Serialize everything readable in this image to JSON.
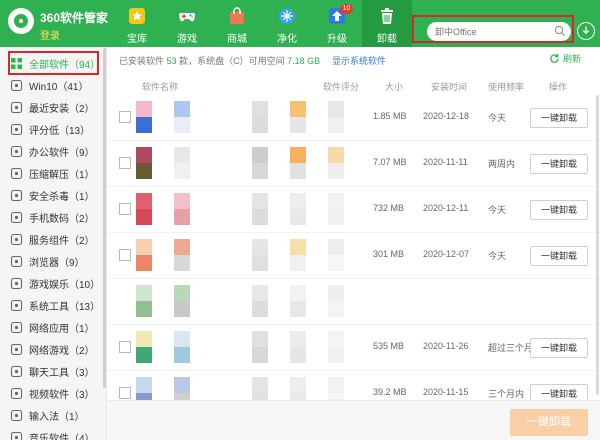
{
  "header": {
    "app_title": "360软件管家",
    "login_label": "登录",
    "nav": [
      {
        "label": "宝库",
        "icon": "star-icon"
      },
      {
        "label": "游戏",
        "icon": "gamepad-icon"
      },
      {
        "label": "商城",
        "icon": "shopping-bag-icon"
      },
      {
        "label": "净化",
        "icon": "purify-icon"
      },
      {
        "label": "升级",
        "icon": "upgrade-icon",
        "badge": "10"
      },
      {
        "label": "卸载",
        "icon": "trash-icon",
        "active": true
      }
    ],
    "search_placeholder": "卸中Office"
  },
  "sidebar": {
    "items": [
      {
        "label": "全部软件（94）",
        "icon": "grid-icon",
        "active": true
      },
      {
        "label": "Win10（41）",
        "icon": "windows-icon"
      },
      {
        "label": "最近安装（2）",
        "icon": "clock-icon"
      },
      {
        "label": "评分低（13）",
        "icon": "thumbs-down-icon"
      },
      {
        "label": "办公软件（9）",
        "icon": "briefcase-icon"
      },
      {
        "label": "压缩解压（1）",
        "icon": "archive-icon"
      },
      {
        "label": "安全杀毒（1）",
        "icon": "shield-icon"
      },
      {
        "label": "手机数码（2）",
        "icon": "phone-icon"
      },
      {
        "label": "服务组件（2）",
        "icon": "gear-icon"
      },
      {
        "label": "浏览器（9）",
        "icon": "globe-icon"
      },
      {
        "label": "游戏娱乐（10）",
        "icon": "game-icon"
      },
      {
        "label": "系统工具（13）",
        "icon": "tools-icon"
      },
      {
        "label": "网络应用（1）",
        "icon": "network-icon"
      },
      {
        "label": "网络游戏（2）",
        "icon": "online-game-icon"
      },
      {
        "label": "聊天工具（3）",
        "icon": "chat-icon"
      },
      {
        "label": "视频软件（3）",
        "icon": "video-icon"
      },
      {
        "label": "输入法（1）",
        "icon": "keyboard-icon"
      },
      {
        "label": "音乐软件（4）",
        "icon": "music-icon"
      }
    ]
  },
  "summary": {
    "prefix": "已安装软件",
    "count": "53",
    "middle": "款，系统盘（C）可用空间",
    "space": "7.18 GB",
    "show_system": "显示系统软件",
    "refresh": "刷新"
  },
  "columns": [
    "软件名称",
    "软件评分",
    "大小",
    "安装时间",
    "使用频率",
    "操作"
  ],
  "rows": [
    {
      "size": "1.85 MB",
      "date": "2020-12-18",
      "freq": "今天",
      "action": "一键卸载",
      "checkbox": true,
      "mosaic": [
        [
          "#f5b8c6",
          "#aac8f0",
          "#e0e0e0",
          "#f8c070",
          "#e8e8e8"
        ],
        [
          "#3b6fd4",
          "#e8eef8",
          "#dcdcdc",
          "#e6e6e6",
          "#f0f0f0"
        ]
      ]
    },
    {
      "size": "7.07 MB",
      "date": "2020-11-11",
      "freq": "两周内",
      "action": "一键卸载",
      "checkbox": true,
      "mosaic": [
        [
          "#b04860",
          "#e8e8e8",
          "#cccccc",
          "#f5b060",
          "#f8d9a8"
        ],
        [
          "#6a5a30",
          "#f0f0f0",
          "#d8d8d8",
          "#e0e0e0",
          "#eeeeee"
        ]
      ]
    },
    {
      "size": "732 MB",
      "date": "2020-12-11",
      "freq": "今天",
      "action": "一键卸载",
      "checkbox": true,
      "mosaic": [
        [
          "#e06070",
          "#f4c0c8",
          "#e4e4e4",
          "#eeeeee",
          "#f2f2f2"
        ],
        [
          "#d84858",
          "#e8a0a8",
          "#dcdcdc",
          "#e8e8e8",
          "#f0f0f0"
        ]
      ]
    },
    {
      "size": "301 MB",
      "date": "2020-12-07",
      "freq": "今天",
      "action": "一键卸载",
      "checkbox": true,
      "mosaic": [
        [
          "#f8d0b0",
          "#f0a890",
          "#e6e6e6",
          "#f4e0a8",
          "#eeeeee"
        ],
        [
          "#e88868",
          "#d8d8d8",
          "#e0e0e0",
          "#f0f0f0",
          "#f6f6f6"
        ]
      ]
    },
    {
      "size": "",
      "date": "",
      "freq": "",
      "action": "",
      "checkbox": false,
      "mosaic": [
        [
          "#d0e4d0",
          "#b8d8b8",
          "#e8e8e8",
          "#f2f2f2",
          "#eeeeee"
        ],
        [
          "#90c090",
          "#c8c8c8",
          "#dcdcdc",
          "#e8e8e8",
          "#f4f4f4"
        ]
      ]
    },
    {
      "size": "535 MB",
      "date": "2020-11-26",
      "freq": "超过三个月",
      "action": "一键卸载",
      "checkbox": true,
      "mosaic": [
        [
          "#f0e8b0",
          "#d8e8f0",
          "#e0e0e0",
          "#ececec",
          "#f4f4f4"
        ],
        [
          "#40a878",
          "#a0c8e0",
          "#d8d8d8",
          "#e6e6e6",
          "#f0f0f0"
        ]
      ]
    },
    {
      "size": "39.2 MB",
      "date": "2020-11-15",
      "freq": "三个月内",
      "action": "一键卸载",
      "checkbox": true,
      "mosaic": [
        [
          "#c8d8f0",
          "#b8c8e8",
          "#e4e4e4",
          "#eeeeee",
          "#f2f2f2"
        ],
        [
          "#8898c8",
          "#d0d0d0",
          "#e0e0e0",
          "#e8e8e8",
          "#f6f6f6"
        ]
      ]
    }
  ],
  "footer": {
    "uninstall_all": "一键卸载"
  },
  "colors": {
    "brand_green": "#2fb152",
    "highlight_red": "#d62828",
    "button_orange": "#f8cfa7"
  }
}
